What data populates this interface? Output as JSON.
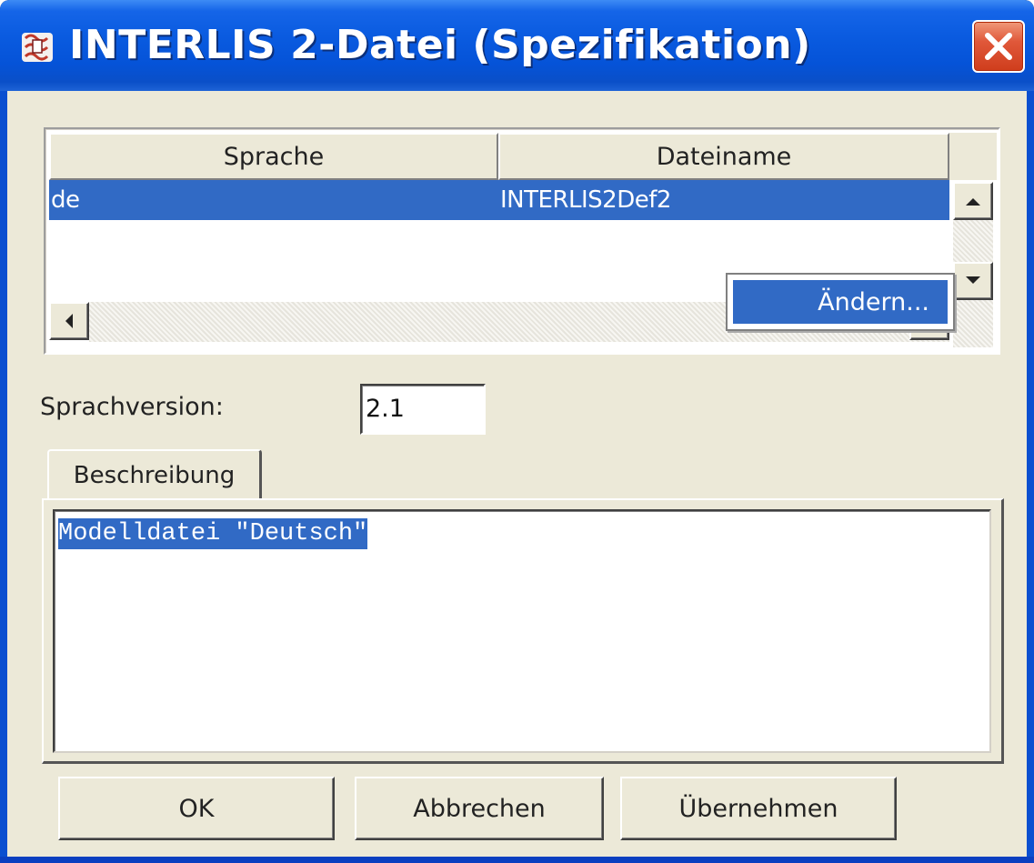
{
  "window": {
    "title": "INTERLIS 2-Datei (Spezifikation)",
    "app_icon": "interlis-app-icon",
    "close_icon": "close-icon"
  },
  "table": {
    "columns": [
      "Sprache",
      "Dateiname"
    ],
    "rows": [
      {
        "sprache": "de",
        "dateiname": "INTERLIS2Def2",
        "selected": true
      }
    ]
  },
  "context_menu": {
    "items": [
      "Ändern..."
    ]
  },
  "form": {
    "sprachversion_label": "Sprachversion:",
    "sprachversion_value": "2.1"
  },
  "tabs": {
    "active": "Beschreibung",
    "items": [
      "Beschreibung"
    ]
  },
  "description": {
    "text": "Modelldatei \"Deutsch\""
  },
  "buttons": {
    "ok": "OK",
    "cancel": "Abbrechen",
    "apply": "Übernehmen"
  },
  "colors": {
    "titlebar": "#0553d8",
    "selection": "#316ac5",
    "dialog_bg": "#ece9d8",
    "close_button": "#e0583a"
  }
}
